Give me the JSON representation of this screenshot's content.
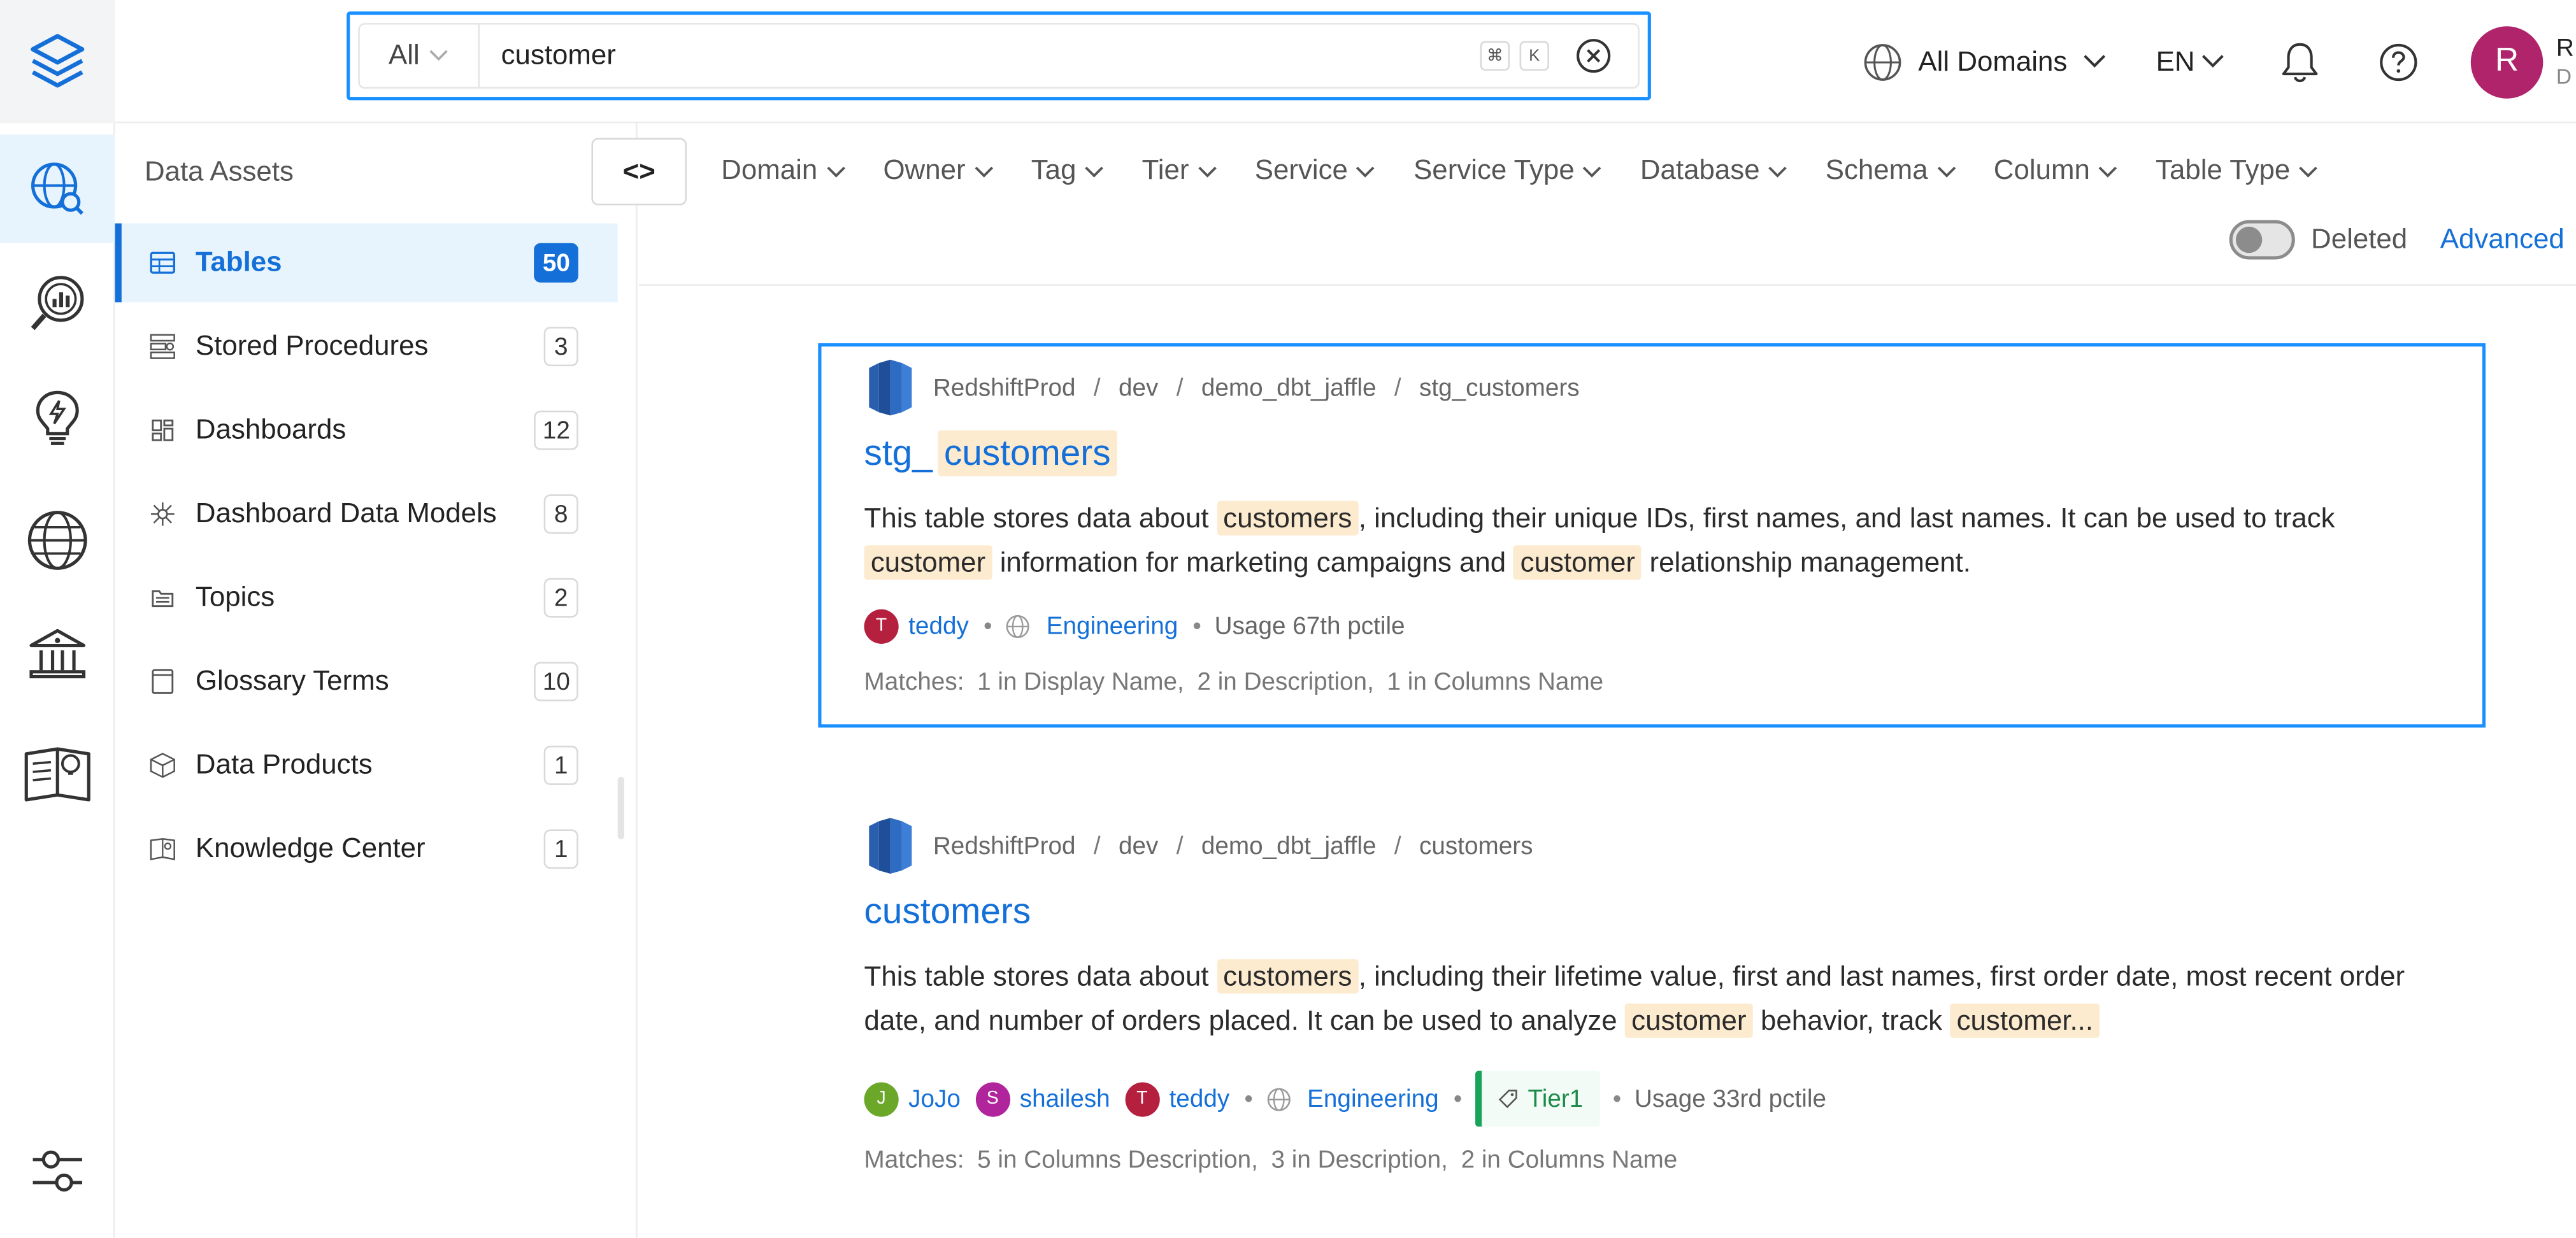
{
  "search": {
    "scope": "All",
    "query": "customer",
    "shortcut_cmd": "⌘",
    "shortcut_key": "K"
  },
  "topbar": {
    "domains_label": "All Domains",
    "language": "EN",
    "avatar_letter": "R",
    "user_initial_line1": "R",
    "user_initial_line2": "D"
  },
  "left_panel": {
    "title": "Data Assets",
    "items": [
      {
        "label": "Tables",
        "count": "50",
        "icon": "table-icon",
        "active": true
      },
      {
        "label": "Stored Procedures",
        "count": "3",
        "icon": "stored-procedure-icon"
      },
      {
        "label": "Dashboards",
        "count": "12",
        "icon": "dashboard-icon"
      },
      {
        "label": "Dashboard Data Models",
        "count": "8",
        "icon": "data-model-icon"
      },
      {
        "label": "Topics",
        "count": "2",
        "icon": "topic-icon"
      },
      {
        "label": "Glossary Terms",
        "count": "10",
        "icon": "glossary-icon"
      },
      {
        "label": "Data Products",
        "count": "1",
        "icon": "data-product-icon"
      },
      {
        "label": "Knowledge Center",
        "count": "1",
        "icon": "knowledge-center-icon"
      }
    ]
  },
  "toolbar": {
    "collapse_label": "<>",
    "filters": [
      "Domain",
      "Owner",
      "Tag",
      "Tier",
      "Service",
      "Service Type",
      "Database",
      "Schema",
      "Column",
      "Table Type"
    ],
    "deleted_label": "Deleted",
    "advanced_label": "Advanced"
  },
  "results": [
    {
      "breadcrumb": [
        "RedshiftProd",
        "dev",
        "demo_dbt_jaffle",
        "stg_customers"
      ],
      "title_prefix": "stg_",
      "title_highlight": "customers",
      "desc": [
        {
          "t": "This table stores data about "
        },
        {
          "t": "customers",
          "hl": true
        },
        {
          "t": ", including their unique IDs, first names, and last names. It can be used to track "
        },
        {
          "t": "customer",
          "hl": true
        },
        {
          "t": " information for marketing campaigns and "
        },
        {
          "t": "customer",
          "hl": true
        },
        {
          "t": " relationship management."
        }
      ],
      "owners": [
        {
          "initial": "T",
          "name": "teddy",
          "color": "#b5203f"
        }
      ],
      "domain": "Engineering",
      "tier": "",
      "usage": "Usage 67th pctile",
      "matches": [
        "Matches:",
        "1 in Display Name,",
        "2 in Description,",
        "1 in Columns Name"
      ]
    },
    {
      "breadcrumb": [
        "RedshiftProd",
        "dev",
        "demo_dbt_jaffle",
        "customers"
      ],
      "title_prefix": "",
      "title_highlight": "customers",
      "desc": [
        {
          "t": "This table stores data about "
        },
        {
          "t": "customers",
          "hl": true
        },
        {
          "t": ", including their lifetime value, first and last names, first order date, most recent order date, and number of orders placed. It can be used to analyze "
        },
        {
          "t": "customer",
          "hl": true
        },
        {
          "t": " behavior, track "
        },
        {
          "t": "customer...",
          "hl": true
        }
      ],
      "owners": [
        {
          "initial": "J",
          "name": "JoJo",
          "color": "#6ba82a"
        },
        {
          "initial": "S",
          "name": "shailesh",
          "color": "#b0249c"
        },
        {
          "initial": "T",
          "name": "teddy",
          "color": "#b5203f"
        }
      ],
      "domain": "Engineering",
      "tier": "Tier1",
      "usage": "Usage 33rd pctile",
      "matches": [
        "Matches:",
        "5 in Columns Description,",
        "3 in Description,",
        "2 in Columns Name"
      ]
    }
  ],
  "colors": {
    "accent": "#1470d8",
    "focus_border": "#1890ff",
    "highlight": "#fdebd0",
    "tier_green": "#17a35a"
  }
}
